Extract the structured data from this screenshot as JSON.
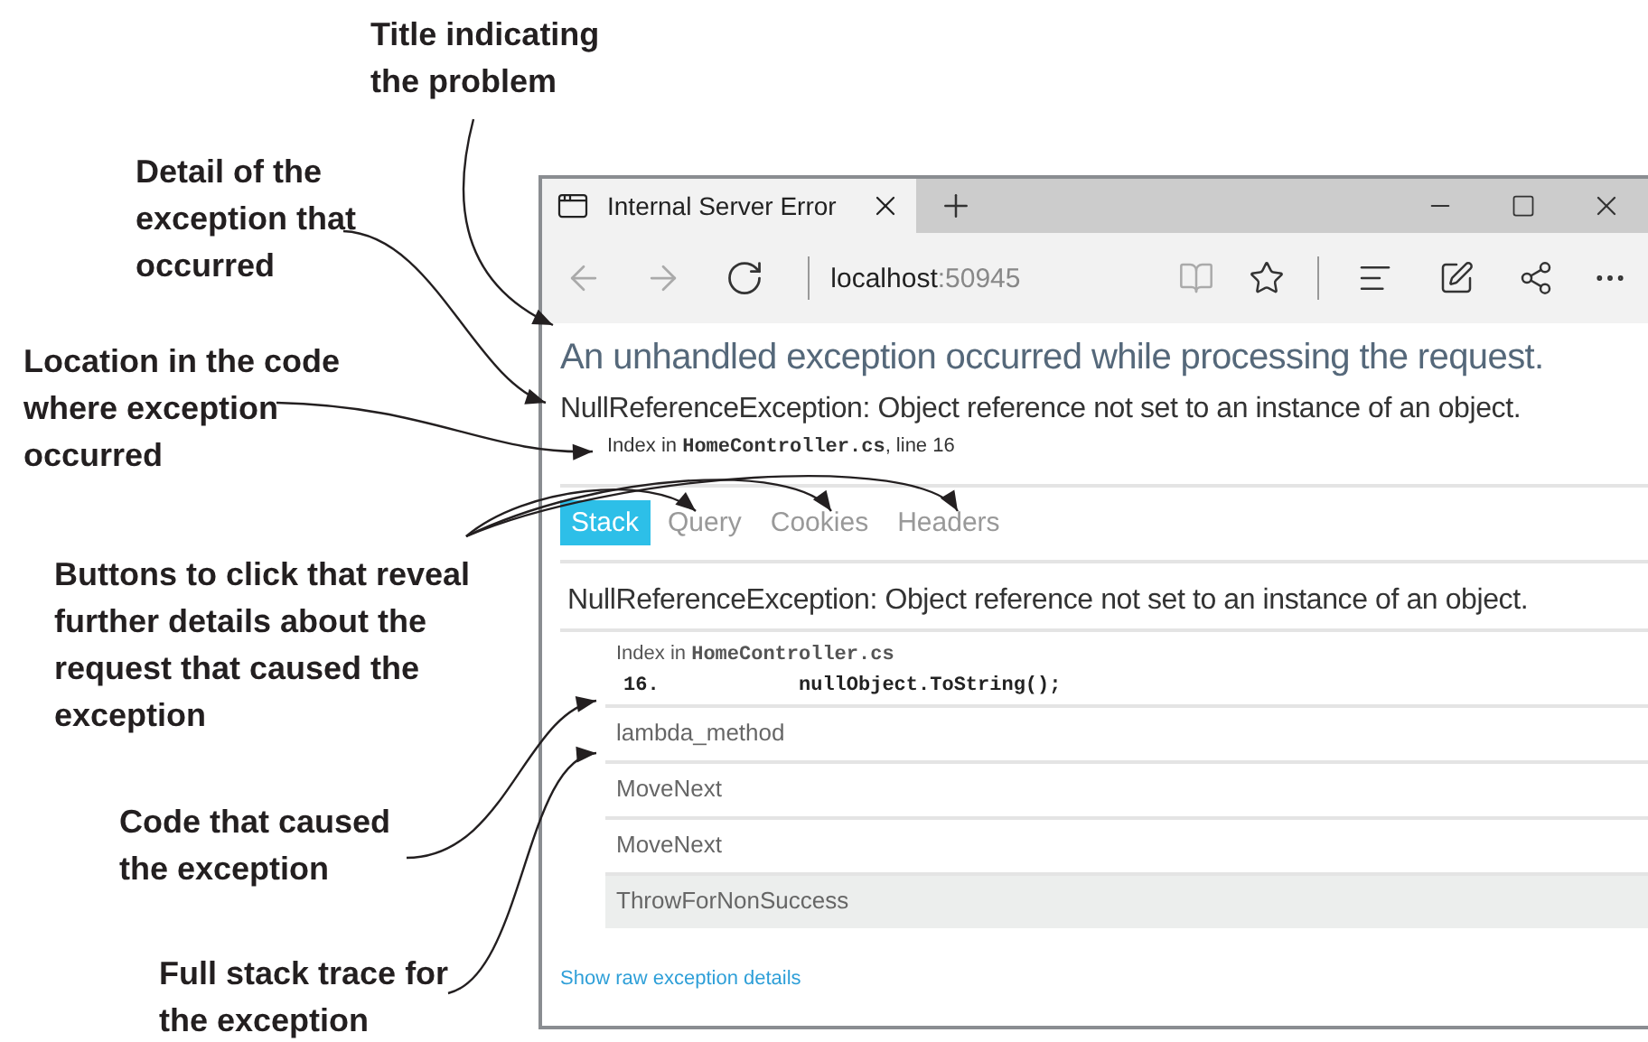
{
  "annotations": [
    {
      "text": "Title indicating the problem"
    },
    {
      "text": "Detail of the exception that occurred"
    },
    {
      "text": "Location in the code where exception occurred"
    },
    {
      "text": "Buttons to click that reveal further details about the request that caused the exception"
    },
    {
      "text": "Code that caused the exception"
    },
    {
      "text": "Full stack trace for the exception"
    }
  ],
  "browser": {
    "tab_title": "Internal Server Error",
    "address_host": "localhost",
    "address_port": ":50945"
  },
  "page": {
    "title": "An unhandled exception occurred while processing the request.",
    "exception": "NullReferenceException: Object reference not set to an instance of an object.",
    "location": {
      "prefix": "Index in ",
      "file": "HomeController.cs",
      "suffix": ", line 16"
    },
    "tabs": [
      {
        "label": "Stack",
        "selected": true
      },
      {
        "label": "Query",
        "selected": false
      },
      {
        "label": "Cookies",
        "selected": false
      },
      {
        "label": "Headers",
        "selected": false
      }
    ],
    "stack": {
      "heading": "NullReferenceException: Object reference not set to an instance of an object.",
      "frames": [
        {
          "kind": "source",
          "prefix": "Index in ",
          "file": "HomeController.cs",
          "line_number": "16.",
          "code": "nullObject.ToString();",
          "highlighted": false
        },
        {
          "kind": "method",
          "name": "lambda_method",
          "highlighted": false
        },
        {
          "kind": "method",
          "name": "MoveNext",
          "highlighted": false
        },
        {
          "kind": "method",
          "name": "MoveNext",
          "highlighted": false
        },
        {
          "kind": "method",
          "name": "ThrowForNonSuccess",
          "highlighted": true
        }
      ]
    },
    "raw_link": "Show raw exception details"
  }
}
